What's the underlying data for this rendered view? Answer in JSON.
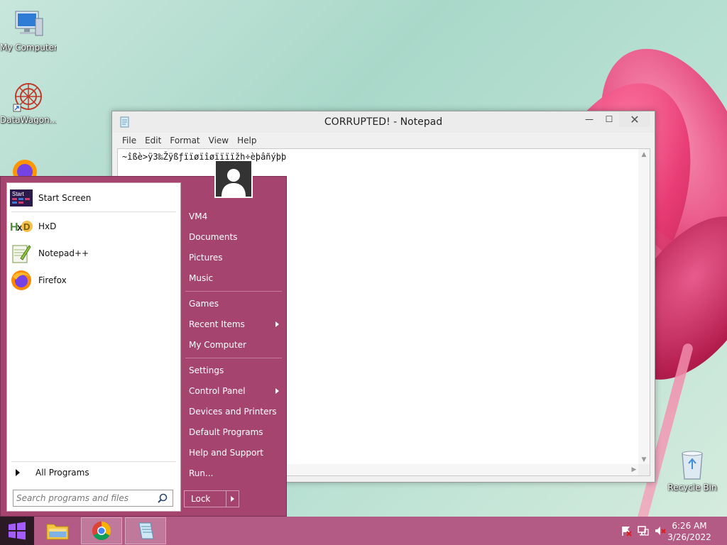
{
  "desktop": {
    "icons": [
      {
        "label": "My Computer"
      },
      {
        "label": "DataWagon..."
      },
      {
        "label": "Recycle Bin"
      }
    ]
  },
  "notepad": {
    "title": "CORRUPTED! - Notepad",
    "menu": [
      "File",
      "Edit",
      "Format",
      "View",
      "Help"
    ],
    "content": "~îßè>ÿ3‰Žÿßƒïïøïîøïïïïžh÷èþâñýþþ",
    "buttons": {
      "minimize": "—",
      "maximize": "☐",
      "close": "✕"
    }
  },
  "start_menu": {
    "pinned": [
      {
        "label": "Start Screen",
        "icon": "start-screen-icon"
      },
      {
        "label": "HxD",
        "icon": "hxd-icon"
      },
      {
        "label": "Notepad++",
        "icon": "notepad-plus-plus-icon"
      },
      {
        "label": "Firefox",
        "icon": "firefox-icon"
      }
    ],
    "start_icon_text": "Start",
    "all_programs": "All Programs",
    "search_placeholder": "Search programs and files",
    "right_items": [
      {
        "label": "VM4"
      },
      {
        "label": "Documents"
      },
      {
        "label": "Pictures"
      },
      {
        "label": "Music"
      },
      {
        "label": "Games"
      },
      {
        "label": "Recent Items",
        "submenu": true
      },
      {
        "label": "My Computer"
      },
      {
        "label": "Settings"
      },
      {
        "label": "Control Panel",
        "submenu": true
      },
      {
        "label": "Devices and Printers"
      },
      {
        "label": "Default Programs"
      },
      {
        "label": "Help and Support"
      },
      {
        "label": "Run..."
      }
    ],
    "lock": "Lock"
  },
  "taskbar": {
    "pinned": [
      "file-explorer-icon",
      "chrome-icon",
      "notepad-icon"
    ],
    "tray": [
      "action-center-flag-icon",
      "network-icon",
      "volume-muted-icon"
    ],
    "time": "6:26 AM",
    "date": "3/26/2022"
  },
  "colors": {
    "start_menu": "#a5456f",
    "taskbar": "#b35b85",
    "start_button": "#2b1a24"
  }
}
